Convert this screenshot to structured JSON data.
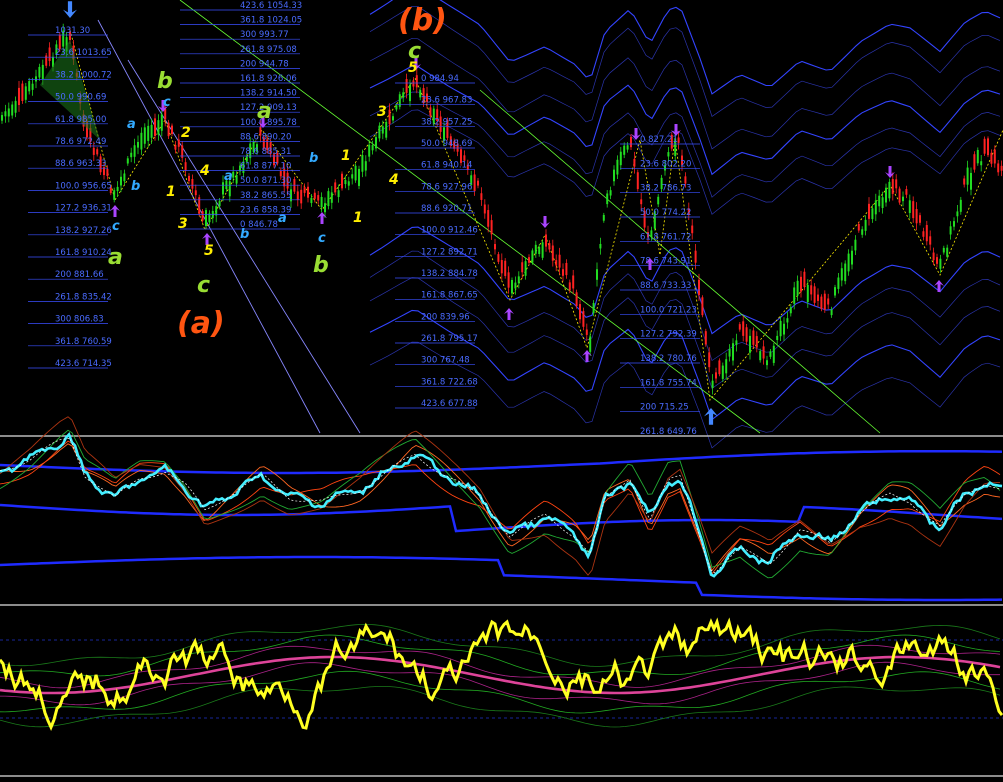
{
  "colors": {
    "background": "#000000",
    "bull_candle": "#22dd22",
    "bear_candle": "#ff2222",
    "fib_text": "#4a6bff",
    "wave_yellow": "#ffee00",
    "wave_cyan": "#33aaff",
    "wave_green": "#99dd33",
    "wave_orange": "#ff5511",
    "osc_cyan": "#44eeff",
    "osc_yellow": "#ffff22",
    "osc_pink": "#dd4499",
    "band_blue": "#1f2bff",
    "trend_green": "#66ff33",
    "arrow_purple": "#aa44ff",
    "arrow_blue": "#4488ff"
  },
  "main_chart": {
    "fib_labels_left": [
      "1031.30",
      "23.6 1013.65",
      "38.2 1000.72",
      "50.0 990.69",
      "61.8 985.00",
      "78.6 972.49",
      "88.6 963.33",
      "100.0 956.65",
      "127.2 936.31",
      "138.2 927.26",
      "161.8 910.24",
      "200 881.66",
      "261.8 835.42",
      "300 806.83",
      "361.8 760.59",
      "423.6 714.35"
    ],
    "fib_labels_mid": [
      "423.6 1054.33",
      "361.8 1024.05",
      "300 993.77",
      "261.8 975.08",
      "200 944.78",
      "161.8 926.06",
      "138.2 914.50",
      "127.2 909.13",
      "100.0 895.78",
      "88.6 890.20",
      "78.6 885.31",
      "61.8 877.10",
      "50.0 871.30",
      "38.2 865.55",
      "23.6 858.39",
      "0 846.78"
    ],
    "fib_labels_center": [
      "0 984.94",
      "23.6 967.83",
      "38.2 957.25",
      "50.0 948.69",
      "61.8 940.14",
      "78.6 927.96",
      "88.6 920.71",
      "100.0 912.46",
      "127.2 892.71",
      "138.2 884.78",
      "161.8 867.65",
      "200 839.96",
      "261.8 795.17",
      "300 767.48",
      "361.8 722.68",
      "423.6 677.88"
    ],
    "fib_labels_right": [
      "0 827.21",
      "23.6 802.20",
      "38.2 786.73",
      "50.0 774.22",
      "61.8 761.72",
      "78.6 743.91",
      "88.6 733.33",
      "100.0 721.23",
      "127.2 792.39",
      "138.2 780.76",
      "161.8 755.74",
      "200 715.25",
      "261.8 649.76"
    ],
    "wave_labels": {
      "b_big": "(b)",
      "a_big": "(a)",
      "c": "c",
      "a": "a",
      "b": "b",
      "n1": "1",
      "n2": "2",
      "n3": "3",
      "n4": "4",
      "n5": "5"
    }
  }
}
